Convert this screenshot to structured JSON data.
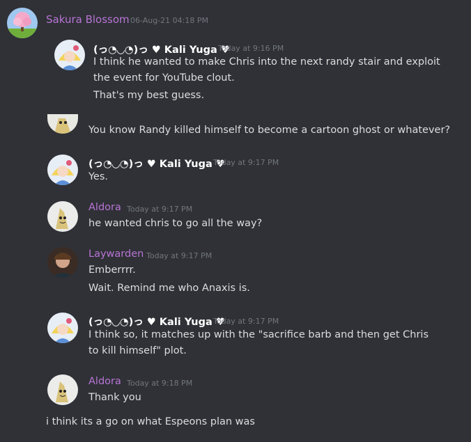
{
  "outer": {
    "author": "Sakura Blossom",
    "timestamp": "06-Aug-21 04:18 PM",
    "footer_text": "i think its a go on what Espeons plan was"
  },
  "quote": {
    "messages": [
      {
        "author": "(っ◔◡◔)っ ♥ Kali Yuga ♥",
        "timestamp": "Today at 9:16 PM",
        "lines": [
          "I think  he wanted to make Chris into the next randy stair and exploit the event for YouTube clout.",
          "That's my best guess."
        ]
      },
      {
        "lines": [
          "You know Randy killed himself to become a cartoon ghost or whatever?"
        ]
      },
      {
        "author": "(っ◔◡◔)っ ♥ Kali Yuga ♥",
        "timestamp": "Today at 9:17 PM",
        "lines": [
          "Yes."
        ]
      },
      {
        "author": "Aldora",
        "timestamp": "Today at 9:17 PM",
        "lines": [
          "he wanted chris to go all the way?"
        ]
      },
      {
        "author": "Laywarden",
        "timestamp": "Today at 9:17 PM",
        "lines": [
          "Emberrrr.",
          "Wait. Remind me who Anaxis is."
        ]
      },
      {
        "author": "(っ◔◡◔)っ ♥ Kali Yuga ♥",
        "timestamp": "Today at 9:17 PM",
        "lines": [
          "I think so, it matches up with the \"sacrifice barb and then get Chris to kill himself\" plot."
        ]
      },
      {
        "author": "Aldora",
        "timestamp": "Today at 9:18 PM",
        "lines": [
          "Thank you"
        ]
      }
    ]
  },
  "colors": {
    "background": "#2f3136",
    "name_purple": "#b974d6",
    "text": "#dcddde",
    "timestamp": "#72767d"
  },
  "icons": {
    "sakura": "cherry-blossom-tree-avatar",
    "kali": "anime-character-avatar",
    "aldora": "mimikyu-avatar",
    "laywarden": "person-photo-avatar"
  }
}
